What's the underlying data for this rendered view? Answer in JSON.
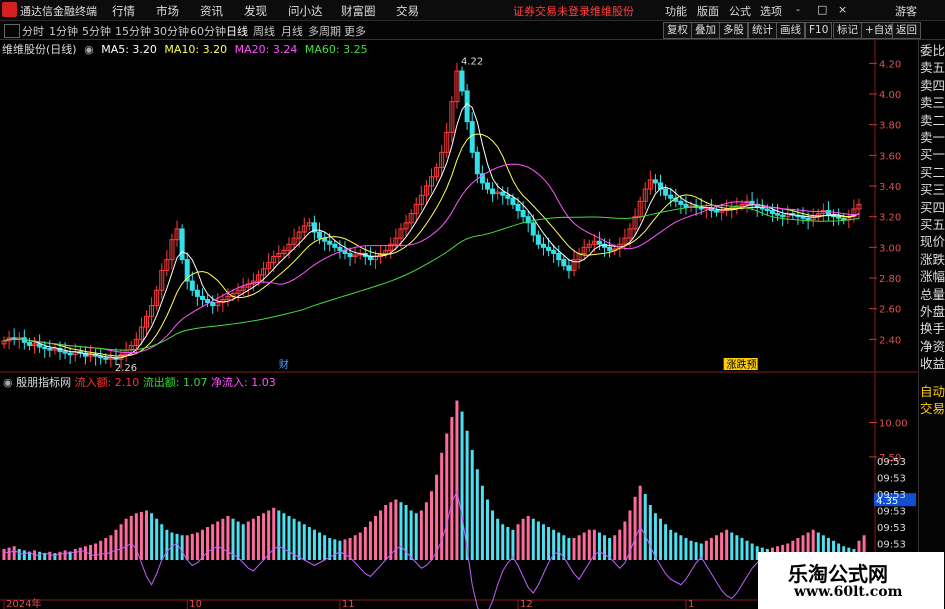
{
  "app": {
    "title": "通达信金融终端"
  },
  "menu": [
    "行情",
    "市场",
    "资讯",
    "发现",
    "问小达",
    "财富圈",
    "交易"
  ],
  "alerts": [
    "证券交易未登录",
    "维维股份"
  ],
  "right_menu": [
    "功能",
    "版面",
    "公式",
    "选项",
    "游客"
  ],
  "window_buttons": [
    "-",
    "□",
    "×"
  ],
  "periods": [
    "分时",
    "1分钟",
    "5分钟",
    "15分钟",
    "30分钟",
    "60分钟",
    "日线",
    "周线",
    "月线",
    "多周期",
    "更多"
  ],
  "active_period": "日线",
  "toolbar": [
    "复权",
    "叠加",
    "多股",
    "统计",
    "画线",
    "F10",
    "标记",
    "+自选",
    "返回"
  ],
  "stock_label": "维维股份(日线)",
  "ma": [
    {
      "label": "MA5: 3.20",
      "color": "#ffffff"
    },
    {
      "label": "MA10: 3.20",
      "color": "#ffff55"
    },
    {
      "label": "MA20: 3.24",
      "color": "#ff55ff"
    },
    {
      "label": "MA60: 3.25",
      "color": "#44dd44"
    }
  ],
  "sub": {
    "name": "殷朋指标网",
    "inflow": "流入额: 2.10",
    "outflow": "流出额: 1.07",
    "net": "净流入: 1.03"
  },
  "right_panel": [
    "委比",
    "卖五",
    "卖四",
    "卖三",
    "卖二",
    "卖一",
    "买一",
    "买二",
    "买三",
    "买四",
    "买五",
    "现价",
    "涨跌",
    "涨幅",
    "总量",
    "外盘",
    "换手",
    "净资",
    "收益"
  ],
  "sub_right": [
    "自动",
    "交易"
  ],
  "sub_times": [
    "09:53",
    "09:53",
    "09:53",
    "09:53",
    "09:53",
    "09:53",
    "09:53",
    "09:53"
  ],
  "sub_value_box": "4.35",
  "annotations": {
    "high": "4.22",
    "low": "2.26",
    "event1": "财",
    "event2": "涨跌预"
  },
  "date_labels": [
    {
      "label": "2024年",
      "i": 0
    },
    {
      "label": "10",
      "i": 36
    },
    {
      "label": "11",
      "i": 66
    },
    {
      "label": "12",
      "i": 101
    },
    {
      "label": "1",
      "i": 134
    },
    {
      "label": "2",
      "i": 166
    }
  ],
  "watermark": {
    "line1": "乐淘公式网",
    "line2": "www.60lt.com"
  },
  "chart_data": {
    "type": "candlestick",
    "ylim": [
      2.2,
      4.3
    ],
    "y_ticks": [
      4.2,
      4.0,
      3.8,
      3.6,
      3.4,
      3.2,
      3.0,
      2.8,
      2.6,
      2.4
    ],
    "sub_ylim": [
      0,
      12
    ],
    "sub_ticks": [
      10.0,
      7.5
    ],
    "closes": [
      2.39,
      2.41,
      2.4,
      2.41,
      2.38,
      2.36,
      2.37,
      2.35,
      2.34,
      2.33,
      2.34,
      2.32,
      2.31,
      2.3,
      2.32,
      2.31,
      2.29,
      2.3,
      2.29,
      2.28,
      2.27,
      2.28,
      2.27,
      2.3,
      2.33,
      2.36,
      2.4,
      2.48,
      2.55,
      2.62,
      2.72,
      2.85,
      2.92,
      3.05,
      3.12,
      2.92,
      2.78,
      2.72,
      2.68,
      2.66,
      2.64,
      2.62,
      2.64,
      2.66,
      2.68,
      2.7,
      2.72,
      2.74,
      2.76,
      2.78,
      2.82,
      2.86,
      2.9,
      2.94,
      2.96,
      2.98,
      3.02,
      3.06,
      3.1,
      3.14,
      3.16,
      3.1,
      3.06,
      3.04,
      3.02,
      3.0,
      2.98,
      2.96,
      2.94,
      2.95,
      2.96,
      2.94,
      2.92,
      2.94,
      2.96,
      2.98,
      3.02,
      3.06,
      3.12,
      3.16,
      3.22,
      3.28,
      3.34,
      3.4,
      3.46,
      3.52,
      3.62,
      3.75,
      3.95,
      4.15,
      4.02,
      3.82,
      3.62,
      3.48,
      3.42,
      3.38,
      3.35,
      3.36,
      3.34,
      3.32,
      3.28,
      3.24,
      3.2,
      3.16,
      3.08,
      3.02,
      3.0,
      2.98,
      2.96,
      2.92,
      2.88,
      2.85,
      2.92,
      2.96,
      3.0,
      3.02,
      3.04,
      3.02,
      3.0,
      2.98,
      2.99,
      3.02,
      3.06,
      3.12,
      3.2,
      3.3,
      3.38,
      3.44,
      3.42,
      3.38,
      3.34,
      3.32,
      3.3,
      3.28,
      3.26,
      3.27,
      3.26,
      3.25,
      3.26,
      3.24,
      3.23,
      3.24,
      3.25,
      3.26,
      3.27,
      3.28,
      3.3,
      3.28,
      3.26,
      3.25,
      3.24,
      3.22,
      3.21,
      3.2,
      3.22,
      3.21,
      3.2,
      3.19,
      3.18,
      3.2,
      3.22,
      3.24,
      3.21,
      3.2,
      3.19,
      3.18,
      3.2,
      3.25,
      3.28
    ],
    "flow": [
      0.8,
      0.9,
      1.0,
      0.8,
      0.7,
      0.6,
      0.7,
      0.6,
      0.5,
      0.6,
      0.5,
      0.6,
      0.7,
      0.6,
      0.8,
      0.9,
      1.0,
      1.1,
      1.2,
      1.4,
      1.6,
      1.8,
      2.2,
      2.6,
      3.0,
      3.2,
      3.4,
      3.5,
      3.6,
      3.4,
      3.0,
      2.6,
      2.2,
      2.0,
      1.9,
      1.8,
      1.8,
      1.9,
      2.0,
      2.2,
      2.4,
      2.6,
      2.8,
      3.0,
      3.2,
      3.0,
      2.8,
      2.6,
      2.8,
      3.0,
      3.2,
      3.4,
      3.6,
      3.8,
      3.6,
      3.4,
      3.2,
      3.0,
      2.8,
      2.6,
      2.4,
      2.2,
      2.0,
      1.8,
      1.6,
      1.5,
      1.4,
      1.5,
      1.6,
      1.8,
      2.0,
      2.4,
      2.8,
      3.2,
      3.6,
      4.0,
      4.2,
      4.4,
      4.2,
      4.0,
      3.6,
      3.4,
      3.6,
      4.2,
      5.0,
      6.2,
      7.8,
      9.2,
      10.4,
      11.6,
      10.8,
      9.4,
      8.0,
      6.6,
      5.4,
      4.4,
      3.6,
      3.0,
      2.6,
      2.4,
      2.2,
      2.6,
      3.0,
      3.2,
      3.0,
      2.8,
      2.6,
      2.4,
      2.2,
      2.0,
      1.8,
      1.6,
      1.6,
      1.8,
      2.0,
      2.2,
      2.2,
      2.0,
      1.8,
      1.6,
      1.8,
      2.2,
      2.8,
      3.6,
      4.6,
      5.4,
      4.8,
      4.0,
      3.4,
      3.0,
      2.6,
      2.2,
      2.0,
      1.8,
      1.6,
      1.4,
      1.3,
      1.2,
      1.4,
      1.6,
      1.8,
      2.0,
      2.2,
      2.0,
      1.8,
      1.6,
      1.4,
      1.2,
      1.0,
      0.9,
      0.8,
      0.9,
      1.0,
      1.1,
      1.2,
      1.4,
      1.6,
      1.8,
      2.0,
      2.2,
      2.0,
      1.8,
      1.6,
      1.4,
      1.2,
      1.0,
      0.9,
      0.8,
      1.4,
      1.8
    ],
    "net_line": [
      0.4,
      0.3,
      0.5,
      0.3,
      0.2,
      0.4,
      0.1,
      0.2,
      0.3,
      0.2,
      0.1,
      0.3,
      0.2,
      0.4,
      0.3,
      0.5,
      0.4,
      0.2,
      0.1,
      0.3,
      0.2,
      0.4,
      0.5,
      0.6,
      0.8,
      1.0,
      0.6,
      -0.4,
      -1.4,
      -2.0,
      -1.2,
      -0.2,
      0.4,
      0.8,
      1.0,
      0.4,
      -0.2,
      -0.6,
      -0.4,
      0.0,
      0.4,
      0.6,
      0.8,
      0.6,
      0.4,
      0.2,
      0.0,
      -0.4,
      -0.8,
      -1.0,
      -0.6,
      -0.2,
      0.2,
      0.6,
      0.8,
      0.6,
      0.4,
      0.2,
      0.0,
      -0.2,
      -0.4,
      -0.6,
      -0.4,
      -0.2,
      0.0,
      0.2,
      0.4,
      0.2,
      0.0,
      -0.4,
      -0.8,
      -1.2,
      -1.4,
      -1.0,
      -0.6,
      -0.2,
      0.2,
      0.6,
      0.8,
      0.4,
      0.0,
      -0.4,
      -0.8,
      -0.6,
      -0.2,
      0.4,
      1.2,
      2.4,
      4.0,
      4.8,
      3.0,
      0.6,
      -2.0,
      -3.6,
      -4.4,
      -4.0,
      -3.2,
      -2.0,
      -1.0,
      -0.4,
      0.0,
      -0.6,
      -1.4,
      -2.2,
      -2.6,
      -2.0,
      -1.2,
      -0.4,
      0.2,
      0.4,
      0.0,
      -0.6,
      -1.2,
      -1.6,
      -1.0,
      -0.4,
      0.2,
      0.4,
      0.2,
      0.0,
      -0.4,
      -0.8,
      -0.4,
      0.4,
      1.4,
      2.2,
      1.6,
      0.8,
      0.0,
      -0.6,
      -1.2,
      -1.6,
      -1.8,
      -2.0,
      -1.6,
      -1.0,
      -0.4,
      0.0,
      -0.6,
      -1.2,
      -1.8,
      -2.4,
      -2.8,
      -3.0,
      -2.6,
      -2.0,
      -1.4,
      -0.8,
      -0.4,
      0.0,
      -0.6,
      -1.2,
      -1.8,
      -2.0,
      -1.8,
      -1.4,
      -1.0,
      -0.6,
      -0.2,
      0.0,
      -0.6,
      -1.2,
      -1.0,
      -0.4,
      0.0,
      0.2
    ]
  }
}
